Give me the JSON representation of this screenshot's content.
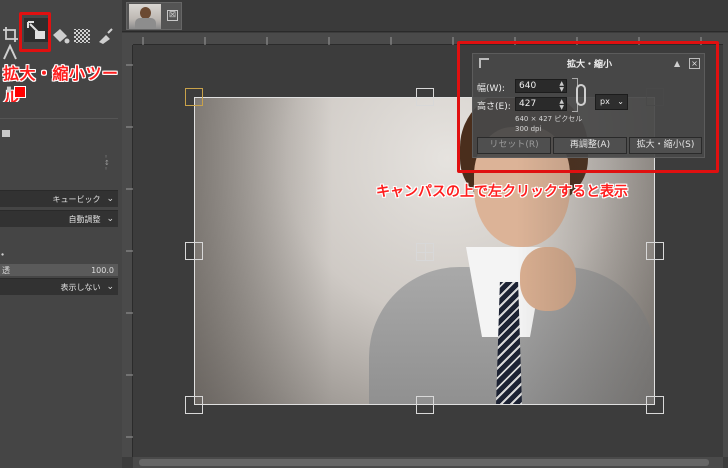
{
  "tab": {
    "close_glyph": "⊠"
  },
  "toolbox": {
    "icons": [
      "crop-icon",
      "scale-icon",
      "bucket-fill-icon",
      "gradient-icon",
      "smudge-icon",
      "text-icon"
    ],
    "fg_color": "#ff0000"
  },
  "tool_options": {
    "interpolation": "キュービック",
    "clipping": "自動調整",
    "opacity_label": "透",
    "opacity_value": "100.0",
    "guides": "表示しない"
  },
  "scale_dialog": {
    "title": "拡大・縮小",
    "width_label": "幅(W):",
    "width_value": "640",
    "height_label": "高さ(E):",
    "height_value": "427",
    "unit": "px",
    "size_info": "640 × 427 ピクセル",
    "dpi_info": "300 dpi",
    "reset_label": "リセット(R)",
    "readjust_label": "再調整(A)",
    "scale_label": "拡大・縮小(S)"
  },
  "annotations": {
    "tool_callout": "拡大・縮小ツール",
    "canvas_callout": "キャンパスの上で左クリックすると表示"
  },
  "colors": {
    "annotation_red": "#e01010"
  }
}
